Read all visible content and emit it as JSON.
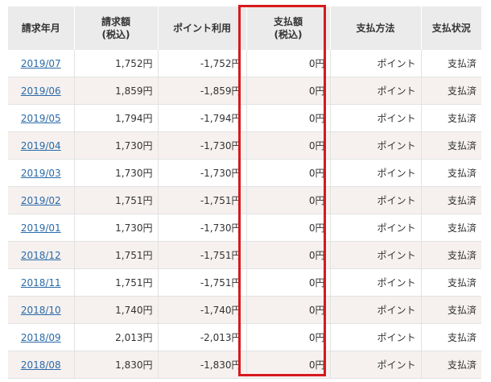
{
  "headers": [
    {
      "line1": "請求年月",
      "line2": ""
    },
    {
      "line1": "請求額",
      "line2": "(税込)"
    },
    {
      "line1": "ポイント利用",
      "line2": ""
    },
    {
      "line1": "支払額",
      "line2": "(税込)"
    },
    {
      "line1": "支払方法",
      "line2": ""
    },
    {
      "line1": "支払状況",
      "line2": ""
    }
  ],
  "rows": [
    {
      "month": "2019/07",
      "billed": "1,752円",
      "points": "-1,752円",
      "paid": "0円",
      "method": "ポイント",
      "status": "支払済"
    },
    {
      "month": "2019/06",
      "billed": "1,859円",
      "points": "-1,859円",
      "paid": "0円",
      "method": "ポイント",
      "status": "支払済"
    },
    {
      "month": "2019/05",
      "billed": "1,794円",
      "points": "-1,794円",
      "paid": "0円",
      "method": "ポイント",
      "status": "支払済"
    },
    {
      "month": "2019/04",
      "billed": "1,730円",
      "points": "-1,730円",
      "paid": "0円",
      "method": "ポイント",
      "status": "支払済"
    },
    {
      "month": "2019/03",
      "billed": "1,730円",
      "points": "-1,730円",
      "paid": "0円",
      "method": "ポイント",
      "status": "支払済"
    },
    {
      "month": "2019/02",
      "billed": "1,751円",
      "points": "-1,751円",
      "paid": "0円",
      "method": "ポイント",
      "status": "支払済"
    },
    {
      "month": "2019/01",
      "billed": "1,730円",
      "points": "-1,730円",
      "paid": "0円",
      "method": "ポイント",
      "status": "支払済"
    },
    {
      "month": "2018/12",
      "billed": "1,751円",
      "points": "-1,751円",
      "paid": "0円",
      "method": "ポイント",
      "status": "支払済"
    },
    {
      "month": "2018/11",
      "billed": "1,751円",
      "points": "-1,751円",
      "paid": "0円",
      "method": "ポイント",
      "status": "支払済"
    },
    {
      "month": "2018/10",
      "billed": "1,740円",
      "points": "-1,740円",
      "paid": "0円",
      "method": "ポイント",
      "status": "支払済"
    },
    {
      "month": "2018/09",
      "billed": "2,013円",
      "points": "-2,013円",
      "paid": "0円",
      "method": "ポイント",
      "status": "支払済"
    },
    {
      "month": "2018/08",
      "billed": "1,830円",
      "points": "-1,830円",
      "paid": "0円",
      "method": "ポイント",
      "status": "支払済"
    }
  ],
  "colors": {
    "header_bg": "#ebebeb",
    "row_alt_bg": "#f6f1ef",
    "link": "#2a6aa8",
    "highlight": "#d7191c"
  }
}
